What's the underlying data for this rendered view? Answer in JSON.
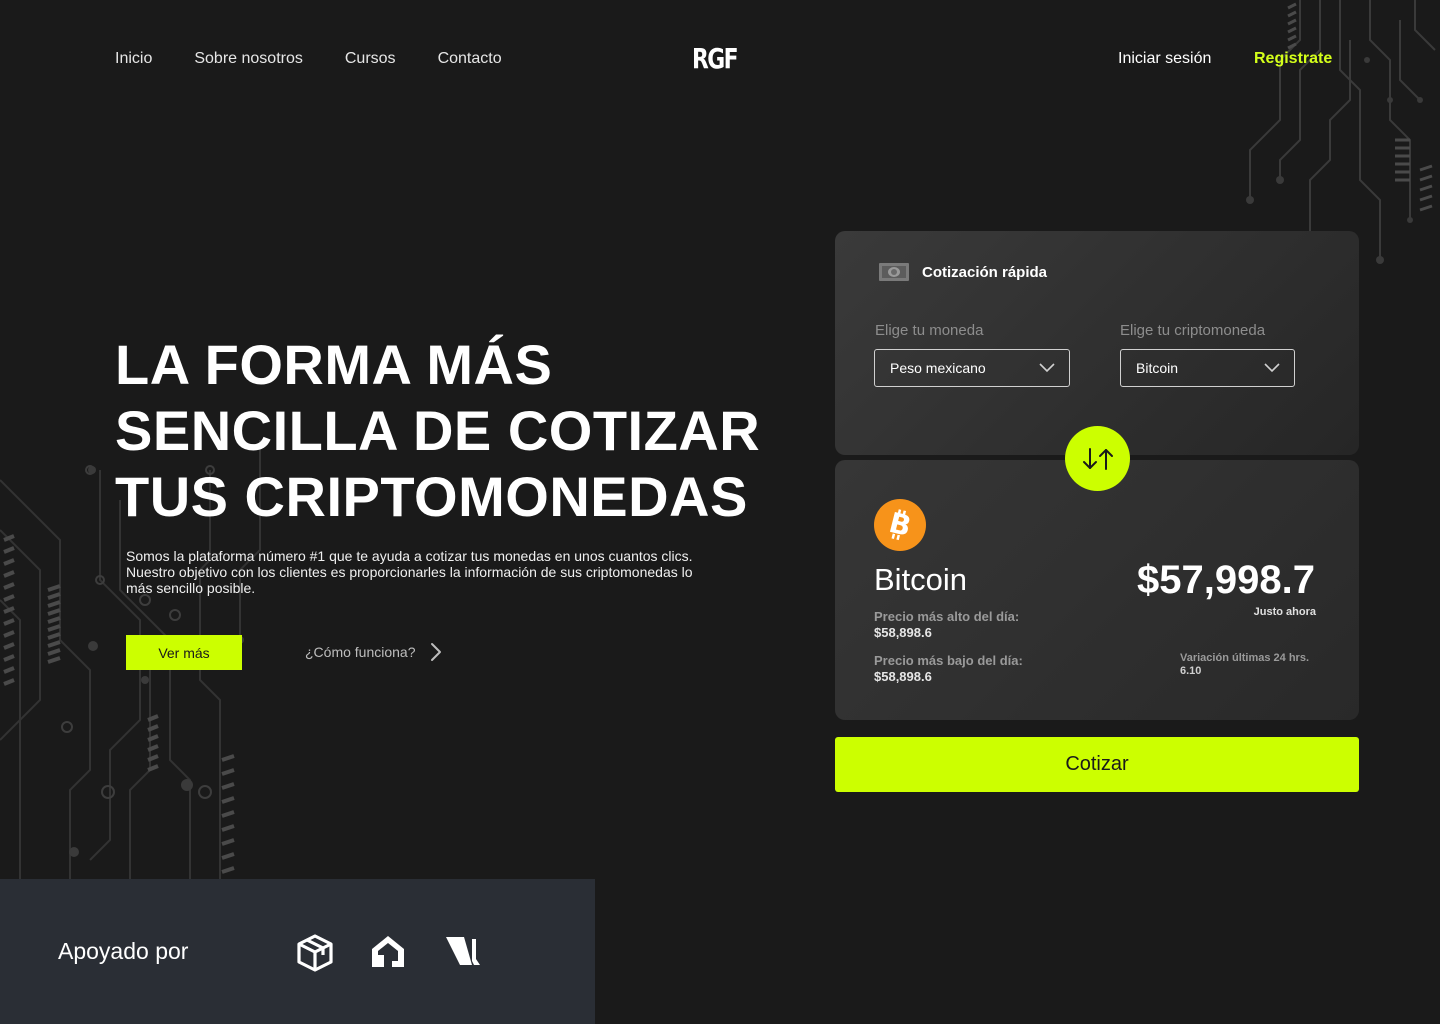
{
  "nav": {
    "links": [
      "Inicio",
      "Sobre nosotros",
      "Cursos",
      "Contacto"
    ],
    "logo": "RGF",
    "login": "Iniciar sesión",
    "register": "Registrate"
  },
  "hero": {
    "title_lines": [
      "LA FORMA MÁS",
      "SENCILLA DE COTIZAR",
      "TUS CRIPTOMONEDAS"
    ],
    "description": "Somos la plataforma número #1 que te ayuda a cotizar tus monedas en unos cuantos clics. Nuestro objetivo con los clientes es proporcionarles la información de sus criptomonedas lo más sencillo posible.",
    "cta_primary": "Ver más",
    "cta_secondary": "¿Cómo funciona?"
  },
  "quote": {
    "title": "Cotización rápida",
    "currency_label": "Elige tu moneda",
    "currency_value": "Peso mexicano",
    "crypto_label": "Elige tu criptomoneda",
    "crypto_value": "Bitcoin",
    "result": {
      "coin_name": "Bitcoin",
      "high_label": "Precio más alto del día:",
      "high_value": "$58,898.6",
      "low_label": "Precio más bajo del día:",
      "low_value": "$58,898.6",
      "price": "$57,998.7",
      "price_note": "Justo ahora",
      "variation_label": "Variación últimas 24 hrs.",
      "variation_value": "6.10"
    },
    "submit": "Cotizar"
  },
  "supported": {
    "title": "Apoyado por",
    "partners": [
      "cube-logo",
      "house-logo",
      "leaf-logo"
    ]
  },
  "colors": {
    "accent": "#ccff00",
    "background": "#1a1a1a",
    "card": "#333333",
    "bitcoin": "#f7931a",
    "supported_bg": "#2a2e35"
  }
}
